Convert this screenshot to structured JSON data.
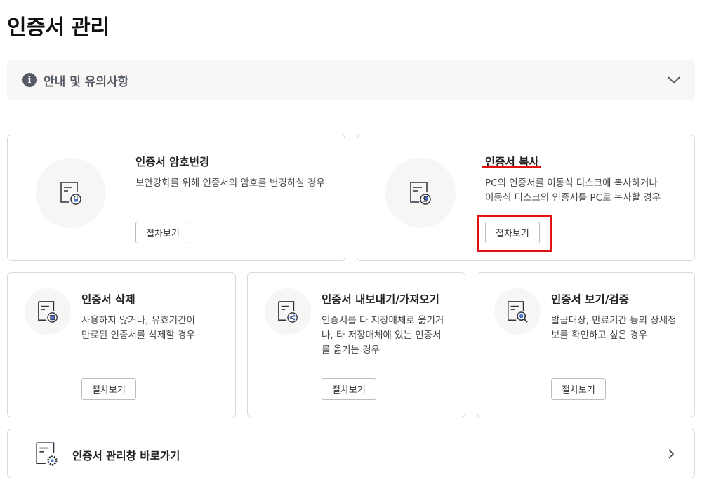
{
  "page": {
    "title": "인증서 관리"
  },
  "notice": {
    "label": "안내 및 유의사항",
    "icon": "info-icon"
  },
  "cards": {
    "change_password": {
      "title": "인증서 암호변경",
      "desc": [
        "보안강화를 위해 인증서의 암호를 변경하실 경우"
      ],
      "button": "절차보기",
      "icon": "certificate-lock-icon"
    },
    "copy": {
      "title": "인증서 복사",
      "desc": [
        "PC의 인증서를 이동식 디스크에 복사하거나",
        "이동식 디스크의 인증서를 PC로 복사할 경우"
      ],
      "button": "절차보기",
      "icon": "certificate-copy-icon"
    },
    "delete": {
      "title": "인증서 삭제",
      "desc": [
        "사용하지 않거나, 유효기간이",
        "만료된 인증서를 삭제할 경우"
      ],
      "button": "절차보기",
      "icon": "certificate-delete-icon"
    },
    "export_import": {
      "title": "인증서 내보내기/가져오기",
      "desc": [
        "인증서를 타 저장매체로 옮기거",
        "나, 타 저장매체에 있는 인증서",
        "를 옮기는 경우"
      ],
      "button": "절차보기",
      "icon": "certificate-share-icon"
    },
    "view_verify": {
      "title": "인증서 보기/검증",
      "desc": [
        "발급대상, 만료기간 등의 상세정",
        "보를 확인하고 싶은 경우"
      ],
      "button": "절차보기",
      "icon": "certificate-search-icon"
    }
  },
  "shortcut": {
    "label": "인증서 관리창 바로가기",
    "icon": "certificate-settings-icon"
  },
  "colors": {
    "highlight": "#e31212",
    "icon_stroke": "#2f3440",
    "icon_accent": "#4a74c9",
    "panel_bg": "#f8f7f5"
  }
}
